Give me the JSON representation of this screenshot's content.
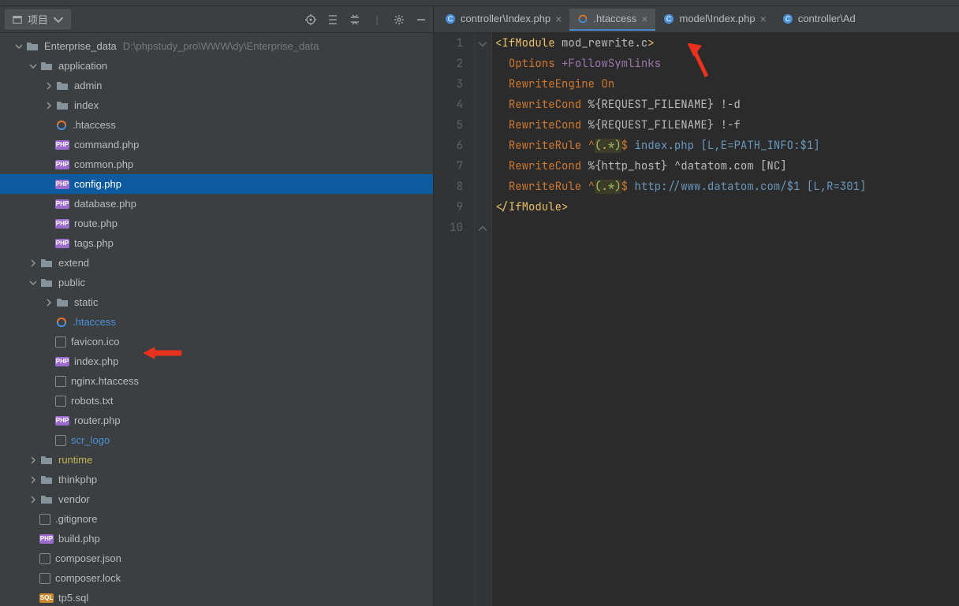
{
  "project": {
    "label": "项目",
    "root_name": "Enterprise_data",
    "root_path": "D:\\phpstudy_pro\\WWW\\dy\\Enterprise_data"
  },
  "tree": [
    {
      "depth": 0,
      "type": "folder",
      "name": "Enterprise_data",
      "expanded": true,
      "has_path": true
    },
    {
      "depth": 1,
      "type": "folder",
      "name": "application",
      "expanded": true
    },
    {
      "depth": 2,
      "type": "folder",
      "name": "admin",
      "collapsed": true
    },
    {
      "depth": 2,
      "type": "folder",
      "name": "index",
      "collapsed": true
    },
    {
      "depth": 2,
      "type": "htaccess",
      "name": ".htaccess"
    },
    {
      "depth": 2,
      "type": "php",
      "name": "command.php"
    },
    {
      "depth": 2,
      "type": "php",
      "name": "common.php"
    },
    {
      "depth": 2,
      "type": "php",
      "name": "config.php",
      "selected": true
    },
    {
      "depth": 2,
      "type": "php",
      "name": "database.php"
    },
    {
      "depth": 2,
      "type": "php",
      "name": "route.php"
    },
    {
      "depth": 2,
      "type": "php",
      "name": "tags.php"
    },
    {
      "depth": 1,
      "type": "folder",
      "name": "extend",
      "collapsed": true
    },
    {
      "depth": 1,
      "type": "folder",
      "name": "public",
      "expanded": true
    },
    {
      "depth": 2,
      "type": "folder",
      "name": "static",
      "collapsed": true
    },
    {
      "depth": 2,
      "type": "htaccess",
      "name": ".htaccess",
      "highlight": true,
      "arrow": true
    },
    {
      "depth": 2,
      "type": "generic",
      "name": "favicon.ico"
    },
    {
      "depth": 2,
      "type": "php",
      "name": "index.php"
    },
    {
      "depth": 2,
      "type": "generic",
      "name": "nginx.htaccess"
    },
    {
      "depth": 2,
      "type": "generic",
      "name": "robots.txt"
    },
    {
      "depth": 2,
      "type": "php",
      "name": "router.php"
    },
    {
      "depth": 2,
      "type": "generic",
      "name": "scr_logo",
      "highlight": true
    },
    {
      "depth": 1,
      "type": "folder",
      "name": "runtime",
      "collapsed": true,
      "runtime": true
    },
    {
      "depth": 1,
      "type": "folder",
      "name": "thinkphp",
      "collapsed": true
    },
    {
      "depth": 1,
      "type": "folder",
      "name": "vendor",
      "collapsed": true
    },
    {
      "depth": 1,
      "type": "generic",
      "name": ".gitignore"
    },
    {
      "depth": 1,
      "type": "php",
      "name": "build.php"
    },
    {
      "depth": 1,
      "type": "generic",
      "name": "composer.json"
    },
    {
      "depth": 1,
      "type": "generic",
      "name": "composer.lock"
    },
    {
      "depth": 1,
      "type": "sql",
      "name": "tp5.sql"
    }
  ],
  "tabs": [
    {
      "label": "controller\\Index.php",
      "icon": "class",
      "active": false
    },
    {
      "label": ".htaccess",
      "icon": "htaccess",
      "active": true,
      "arrow": true
    },
    {
      "label": "model\\Index.php",
      "icon": "class",
      "active": false
    },
    {
      "label": "controller\\Ad",
      "icon": "class",
      "active": false,
      "noclose": true
    }
  ],
  "editor": {
    "lines": [
      {
        "n": 1,
        "tokens": [
          {
            "t": "<",
            "c": "c-tag"
          },
          {
            "t": "IfModule",
            "c": "c-tag"
          },
          {
            "t": " "
          },
          {
            "t": "mod_rewrite.c",
            "c": "c-attr"
          },
          {
            "t": ">",
            "c": "c-tag"
          }
        ],
        "fold": "open"
      },
      {
        "n": 2,
        "indent": 1,
        "tokens": [
          {
            "t": "Options",
            "c": "c-kw"
          },
          {
            "t": " "
          },
          {
            "t": "+FollowSymlinks",
            "c": "c-opt"
          }
        ]
      },
      {
        "n": 3,
        "indent": 1,
        "tokens": [
          {
            "t": "RewriteEngine",
            "c": "c-kw"
          },
          {
            "t": " "
          },
          {
            "t": "On",
            "c": "c-kw"
          }
        ]
      },
      {
        "n": 4,
        "indent": 0,
        "tokens": []
      },
      {
        "n": 5,
        "indent": 1,
        "tokens": [
          {
            "t": "RewriteCond",
            "c": "c-kw"
          },
          {
            "t": " "
          },
          {
            "t": "%{REQUEST_FILENAME} !-d",
            "c": "c-attr"
          }
        ]
      },
      {
        "n": 6,
        "indent": 1,
        "tokens": [
          {
            "t": "RewriteCond",
            "c": "c-kw"
          },
          {
            "t": " "
          },
          {
            "t": "%{REQUEST_FILENAME} !-f",
            "c": "c-attr"
          }
        ]
      },
      {
        "n": 7,
        "indent": 1,
        "tokens": [
          {
            "t": "RewriteRule",
            "c": "c-kw"
          },
          {
            "t": " "
          },
          {
            "t": "^",
            "c": "c-reg"
          },
          {
            "t": "(.*)",
            "c": "c-rx"
          },
          {
            "t": "$",
            "c": "c-reg"
          },
          {
            "t": " "
          },
          {
            "t": "index.php",
            "c": "c-url"
          },
          {
            "t": " "
          },
          {
            "t": "[L,E=PATH_INFO:$1]",
            "c": "c-flag"
          }
        ]
      },
      {
        "n": 8,
        "indent": 1,
        "tokens": [
          {
            "t": "RewriteCond",
            "c": "c-kw"
          },
          {
            "t": " "
          },
          {
            "t": "%{http_host} ^datatom.com [NC]",
            "c": "c-attr"
          }
        ]
      },
      {
        "n": 9,
        "indent": 1,
        "tokens": [
          {
            "t": "RewriteRule",
            "c": "c-kw"
          },
          {
            "t": " "
          },
          {
            "t": "^",
            "c": "c-reg"
          },
          {
            "t": "(.*)",
            "c": "c-rx"
          },
          {
            "t": "$",
            "c": "c-reg"
          },
          {
            "t": " "
          },
          {
            "t": "http://www.datatom.com/$1",
            "c": "c-url"
          },
          {
            "t": " "
          },
          {
            "t": "[L,R=301]",
            "c": "c-flag"
          }
        ]
      },
      {
        "n": 10,
        "tokens": [
          {
            "t": "</",
            "c": "c-tag"
          },
          {
            "t": "IfModule",
            "c": "c-tag"
          },
          {
            "t": ">",
            "c": "c-tag"
          }
        ],
        "fold": "close"
      }
    ]
  }
}
